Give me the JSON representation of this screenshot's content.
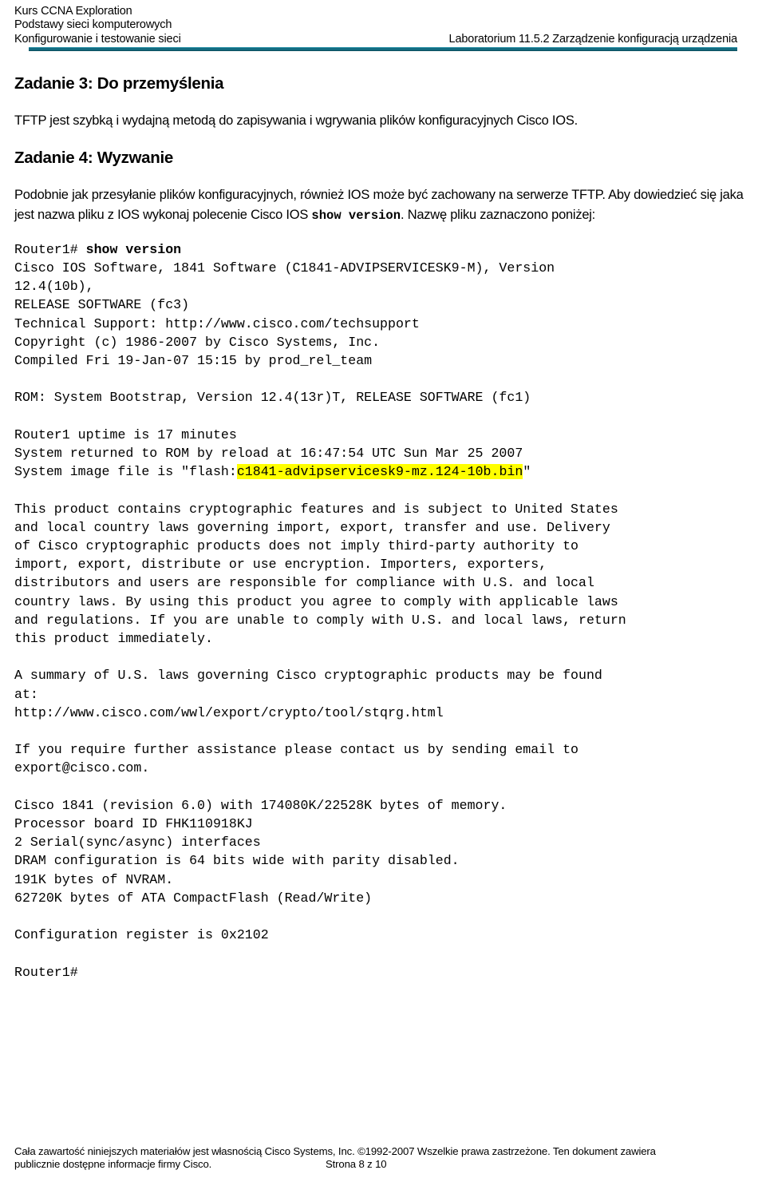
{
  "header": {
    "lines": [
      "Kurs CCNA Exploration",
      "Podstawy sieci komputerowych",
      "Konfigurowanie i testowanie sieci"
    ],
    "right_title": "Laboratorium 11.5.2 Zarządzenie konfiguracją urządzenia",
    "rule_color": "#136B80"
  },
  "content": {
    "task3_heading": "Zadanie 3: Do przemyślenia",
    "task3_paragraph": "TFTP jest szybką i wydajną metodą do zapisywania i wgrywania plików konfiguracyjnych Cisco IOS.",
    "task4_heading": "Zadanie 4: Wyzwanie",
    "task4_paragraph_part1": "Podobnie jak przesyłanie plików konfiguracyjnych, również IOS może być zachowany na serwerze TFTP. Aby dowiedzieć się jaka jest nazwa pliku z IOS wykonaj polecenie Cisco IOS ",
    "task4_command": "show version",
    "task4_paragraph_part2": ". Nazwę pliku zaznaczono poniżej:"
  },
  "terminal": {
    "prompt": "Router1# ",
    "command": "show version",
    "block_before_highlight": "Cisco IOS Software, 1841 Software (C1841-ADVIPSERVICESK9-M), Version\n12.4(10b),\nRELEASE SOFTWARE (fc3)\nTechnical Support: http://www.cisco.com/techsupport\nCopyright (c) 1986-2007 by Cisco Systems, Inc.\nCompiled Fri 19-Jan-07 15:15 by prod_rel_team\n\nROM: System Bootstrap, Version 12.4(13r)T, RELEASE SOFTWARE (fc1)\n\nRouter1 uptime is 17 minutes\nSystem returned to ROM by reload at 16:47:54 UTC Sun Mar 25 2007\nSystem image file is \"flash:",
    "highlighted_filename": "c1841-advipservicesk9-mz.124-10b.bin",
    "block_after_highlight": "\"\n\nThis product contains cryptographic features and is subject to United States\nand local country laws governing import, export, transfer and use. Delivery\nof Cisco cryptographic products does not imply third-party authority to\nimport, export, distribute or use encryption. Importers, exporters,\ndistributors and users are responsible for compliance with U.S. and local\ncountry laws. By using this product you agree to comply with applicable laws\nand regulations. If you are unable to comply with U.S. and local laws, return\nthis product immediately.\n\nA summary of U.S. laws governing Cisco cryptographic products may be found\nat:\nhttp://www.cisco.com/wwl/export/crypto/tool/stqrg.html\n\nIf you require further assistance please contact us by sending email to\nexport@cisco.com.\n\nCisco 1841 (revision 6.0) with 174080K/22528K bytes of memory.\nProcessor board ID FHK110918KJ\n2 Serial(sync/async) interfaces\nDRAM configuration is 64 bits wide with parity disabled.\n191K bytes of NVRAM.\n62720K bytes of ATA CompactFlash (Read/Write)\n\nConfiguration register is 0x2102\n\nRouter1#",
    "highlight_color": "#FFFF00"
  },
  "footer": {
    "line1": "Cała zawartość niniejszych materiałów jest własnością Cisco Systems, Inc. ©1992-2007 Wszelkie prawa zastrzeżone. Ten dokument zawiera",
    "line2": "publicznie dostępne informacje firmy Cisco.",
    "page_label": "Strona 8 z 10"
  }
}
